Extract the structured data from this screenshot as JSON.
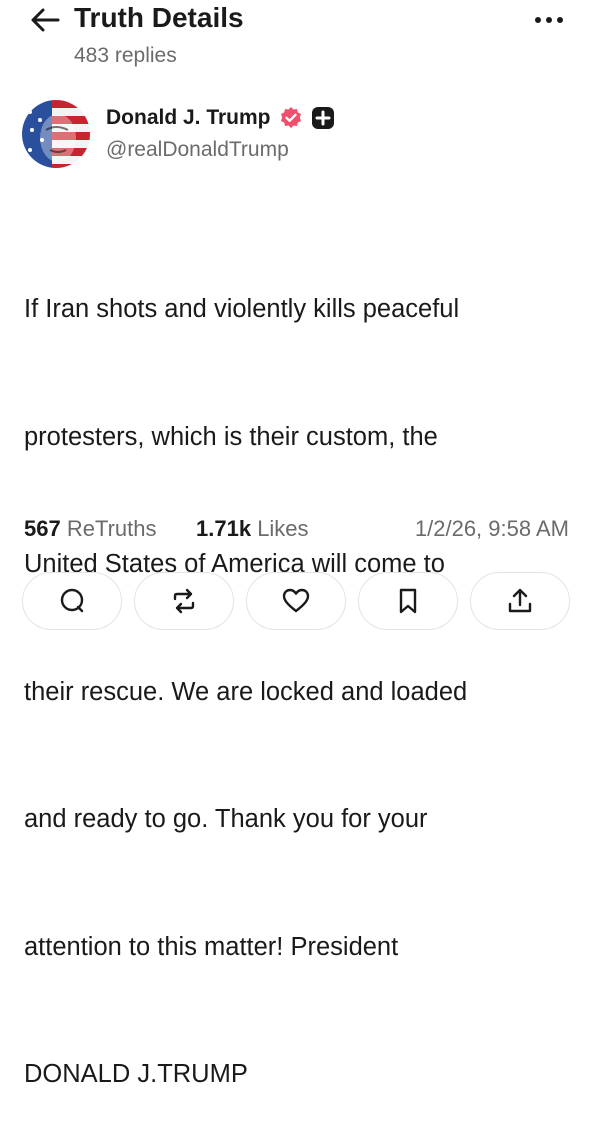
{
  "header": {
    "title": "Truth Details",
    "subtitle": "483 replies"
  },
  "author": {
    "name": "Donald J. Trump",
    "handle": "@realDonaldTrump"
  },
  "post": {
    "lines": [
      "If Iran shots and violently kills peaceful",
      "protesters, which is their custom, the",
      "United States of America will come to",
      "their rescue. We are locked and loaded",
      "and ready to go. Thank you for your",
      "attention to this matter! President",
      "DONALD J.TRUMP"
    ]
  },
  "stats": {
    "retruths_count": "567",
    "retruths_label": "ReTruths",
    "likes_count": "1.71k",
    "likes_label": "Likes",
    "timestamp": "1/2/26, 9:58 AM"
  },
  "colors": {
    "verified_badge": "#f0506e",
    "text_primary": "#1a1a1a",
    "text_secondary": "#6b6b6b",
    "border": "#e3e3e3"
  },
  "icons": {
    "back": "arrow-left-icon",
    "more": "more-horizontal-icon",
    "verified": "verified-badge-icon",
    "plus": "truth-plus-icon",
    "reply": "comment-icon",
    "retruth": "repost-icon",
    "like": "heart-icon",
    "bookmark": "bookmark-icon",
    "share": "share-icon"
  }
}
